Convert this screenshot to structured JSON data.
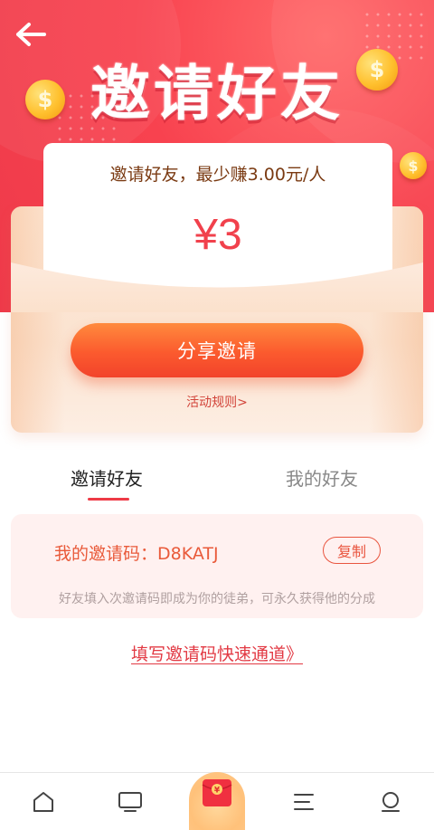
{
  "header": {
    "title": "邀请好友",
    "back_icon": "arrow-left-icon",
    "coin_symbol": "$"
  },
  "reward_card": {
    "caption": "邀请好友，最少赚3.00元/人",
    "amount": "¥3",
    "share_button_label": "分享邀请",
    "rules_link": "活动规则>"
  },
  "tabs": [
    {
      "label": "邀请好友",
      "active": true
    },
    {
      "label": "我的好友",
      "active": false
    }
  ],
  "invite_code": {
    "label": "我的邀请码：D8KATJ",
    "copy_button_label": "复制",
    "tip": "好友填入次邀请码即成为你的徒弟，可永久获得他的分成"
  },
  "fast_link": "填写邀请码快速通道》",
  "bottom_nav": {
    "items": [
      {
        "icon": "home-icon"
      },
      {
        "icon": "tv-icon"
      },
      {
        "icon": "red-envelope-icon",
        "glyph": "¥"
      },
      {
        "icon": "menu-icon"
      },
      {
        "icon": "profile-icon"
      }
    ]
  },
  "colors": {
    "hero_red": "#f8424f",
    "accent_orange": "#fb5a2e",
    "amount_red": "#f1414c"
  }
}
